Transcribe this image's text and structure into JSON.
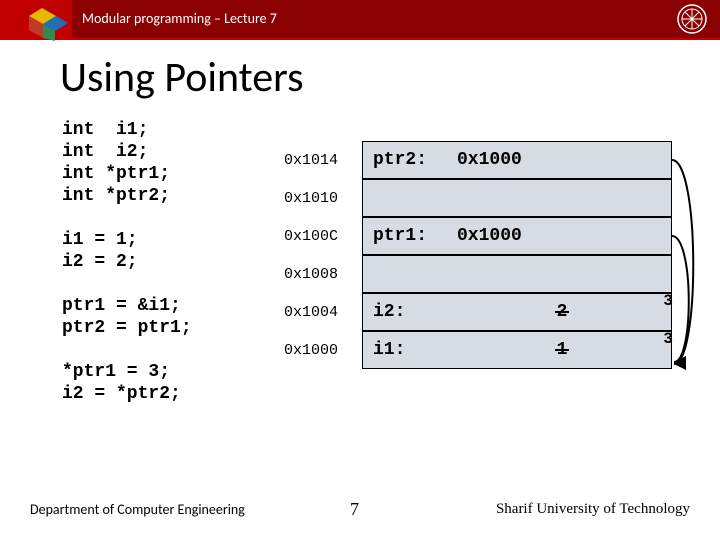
{
  "header": {
    "course": "Modular programming – Lecture 7"
  },
  "title": "Using Pointers",
  "code": {
    "decl": "int  i1;\nint  i2;\nint *ptr1;\nint *ptr2;",
    "init": "i1 = 1;\ni2 = 2;",
    "assign": "ptr1 = &i1;\nptr2 = ptr1;",
    "deref": "*ptr1 = 3;\ni2 = *ptr2;"
  },
  "addresses": [
    "0x1014",
    "0x1010",
    "0x100C",
    "0x1008",
    "0x1004",
    "0x1000"
  ],
  "memory": [
    {
      "label": "ptr2:",
      "value": "0x1000",
      "centered": false
    },
    {
      "label": "",
      "value": "",
      "empty": true
    },
    {
      "label": "ptr1:",
      "value": "0x1000",
      "centered": false
    },
    {
      "label": "",
      "value": "",
      "empty": true
    },
    {
      "label": "i2:",
      "value_old": "2",
      "value_new": "3",
      "centered": true
    },
    {
      "label": "i1:",
      "value_old": "1",
      "value_new": "3",
      "centered": true
    }
  ],
  "footer": {
    "dept": "Department of Computer Engineering",
    "page": "7",
    "uni": "Sharif University of Technology"
  }
}
